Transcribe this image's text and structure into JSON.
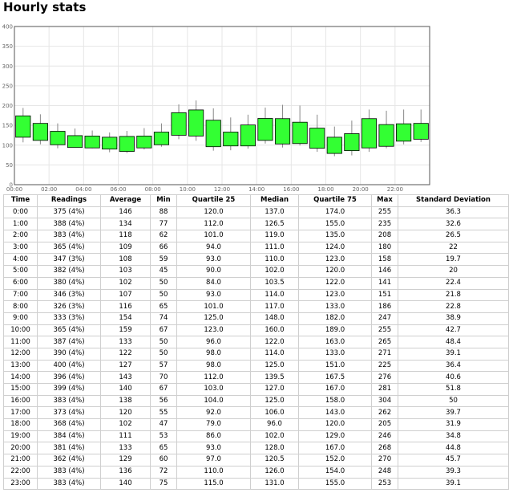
{
  "page": {
    "title": "Hourly stats"
  },
  "chart_data": {
    "type": "candlestick",
    "x": [
      "0:00",
      "1:00",
      "2:00",
      "3:00",
      "4:00",
      "5:00",
      "6:00",
      "7:00",
      "8:00",
      "9:00",
      "10:00",
      "11:00",
      "12:00",
      "13:00",
      "14:00",
      "15:00",
      "16:00",
      "17:00",
      "18:00",
      "19:00",
      "20:00",
      "21:00",
      "22:00",
      "23:00"
    ],
    "x_tick_labels": [
      "00:00",
      "02:00",
      "04:00",
      "06:00",
      "08:00",
      "10:00",
      "12:00",
      "14:00",
      "16:00",
      "18:00",
      "20:00",
      "22:00"
    ],
    "y_tick_labels": [
      "0",
      "50",
      "100",
      "150",
      "200",
      "250",
      "300",
      "350",
      "400"
    ],
    "ylim": [
      0,
      400
    ],
    "box_low": [
      120.0,
      112.0,
      101.0,
      94.0,
      93.0,
      90.0,
      84.0,
      93.0,
      101.0,
      125.0,
      123.0,
      96.0,
      98.0,
      98.0,
      112.0,
      103.0,
      104.0,
      92.0,
      79.0,
      86.0,
      93.0,
      97.0,
      110.0,
      115.0
    ],
    "box_high": [
      174.0,
      155.0,
      135.0,
      124.0,
      123.0,
      120.0,
      122.0,
      123.0,
      133.0,
      182.0,
      189.0,
      163.0,
      133.0,
      151.0,
      167.5,
      167.0,
      158.0,
      143.0,
      120.0,
      129.0,
      167.0,
      152.0,
      154.0,
      155.0
    ],
    "whisker_high": [
      194,
      178,
      155,
      142,
      137,
      132,
      136,
      143,
      155,
      203,
      213,
      193,
      170,
      177,
      195,
      202,
      200,
      177,
      147,
      162,
      190,
      187,
      190,
      190
    ],
    "whisker_low": [
      107,
      102,
      92,
      94,
      92,
      82,
      80,
      89,
      96,
      115,
      111,
      86,
      87,
      91,
      104,
      94,
      99,
      83,
      72,
      74,
      83,
      92,
      102,
      108
    ],
    "box_color": "#33ff33",
    "box_stroke": "#000000",
    "grid": true
  },
  "table": {
    "headers": [
      "Time",
      "Readings",
      "Average",
      "Min",
      "Quartile 25",
      "Median",
      "Quartile 75",
      "Max",
      "Standard Deviation"
    ],
    "rows": [
      [
        "0:00",
        "375 (4%)",
        "146",
        "88",
        "120.0",
        "137.0",
        "174.0",
        "255",
        "36.3"
      ],
      [
        "1:00",
        "388 (4%)",
        "134",
        "77",
        "112.0",
        "126.5",
        "155.0",
        "235",
        "32.6"
      ],
      [
        "2:00",
        "383 (4%)",
        "118",
        "62",
        "101.0",
        "119.0",
        "135.0",
        "208",
        "26.5"
      ],
      [
        "3:00",
        "365 (4%)",
        "109",
        "66",
        "94.0",
        "111.0",
        "124.0",
        "180",
        "22"
      ],
      [
        "4:00",
        "347 (3%)",
        "108",
        "59",
        "93.0",
        "110.0",
        "123.0",
        "158",
        "19.7"
      ],
      [
        "5:00",
        "382 (4%)",
        "103",
        "45",
        "90.0",
        "102.0",
        "120.0",
        "146",
        "20"
      ],
      [
        "6:00",
        "380 (4%)",
        "102",
        "50",
        "84.0",
        "103.5",
        "122.0",
        "141",
        "22.4"
      ],
      [
        "7:00",
        "346 (3%)",
        "107",
        "50",
        "93.0",
        "114.0",
        "123.0",
        "151",
        "21.8"
      ],
      [
        "8:00",
        "326 (3%)",
        "116",
        "65",
        "101.0",
        "117.0",
        "133.0",
        "186",
        "22.8"
      ],
      [
        "9:00",
        "333 (3%)",
        "154",
        "74",
        "125.0",
        "148.0",
        "182.0",
        "247",
        "38.9"
      ],
      [
        "10:00",
        "365 (4%)",
        "159",
        "67",
        "123.0",
        "160.0",
        "189.0",
        "255",
        "42.7"
      ],
      [
        "11:00",
        "387 (4%)",
        "133",
        "50",
        "96.0",
        "122.0",
        "163.0",
        "265",
        "48.4"
      ],
      [
        "12:00",
        "390 (4%)",
        "122",
        "50",
        "98.0",
        "114.0",
        "133.0",
        "271",
        "39.1"
      ],
      [
        "13:00",
        "400 (4%)",
        "127",
        "57",
        "98.0",
        "125.0",
        "151.0",
        "225",
        "36.4"
      ],
      [
        "14:00",
        "396 (4%)",
        "143",
        "70",
        "112.0",
        "139.5",
        "167.5",
        "276",
        "40.6"
      ],
      [
        "15:00",
        "399 (4%)",
        "140",
        "67",
        "103.0",
        "127.0",
        "167.0",
        "281",
        "51.8"
      ],
      [
        "16:00",
        "383 (4%)",
        "138",
        "56",
        "104.0",
        "125.0",
        "158.0",
        "304",
        "50"
      ],
      [
        "17:00",
        "373 (4%)",
        "120",
        "55",
        "92.0",
        "106.0",
        "143.0",
        "262",
        "39.7"
      ],
      [
        "18:00",
        "368 (4%)",
        "102",
        "47",
        "79.0",
        "96.0",
        "120.0",
        "205",
        "31.9"
      ],
      [
        "19:00",
        "384 (4%)",
        "111",
        "53",
        "86.0",
        "102.0",
        "129.0",
        "246",
        "34.8"
      ],
      [
        "20:00",
        "381 (4%)",
        "133",
        "65",
        "93.0",
        "128.0",
        "167.0",
        "268",
        "44.8"
      ],
      [
        "21:00",
        "362 (4%)",
        "129",
        "60",
        "97.0",
        "120.5",
        "152.0",
        "270",
        "45.7"
      ],
      [
        "22:00",
        "383 (4%)",
        "136",
        "72",
        "110.0",
        "126.0",
        "154.0",
        "248",
        "39.3"
      ],
      [
        "23:00",
        "383 (4%)",
        "140",
        "75",
        "115.0",
        "131.0",
        "155.0",
        "253",
        "39.1"
      ]
    ]
  }
}
